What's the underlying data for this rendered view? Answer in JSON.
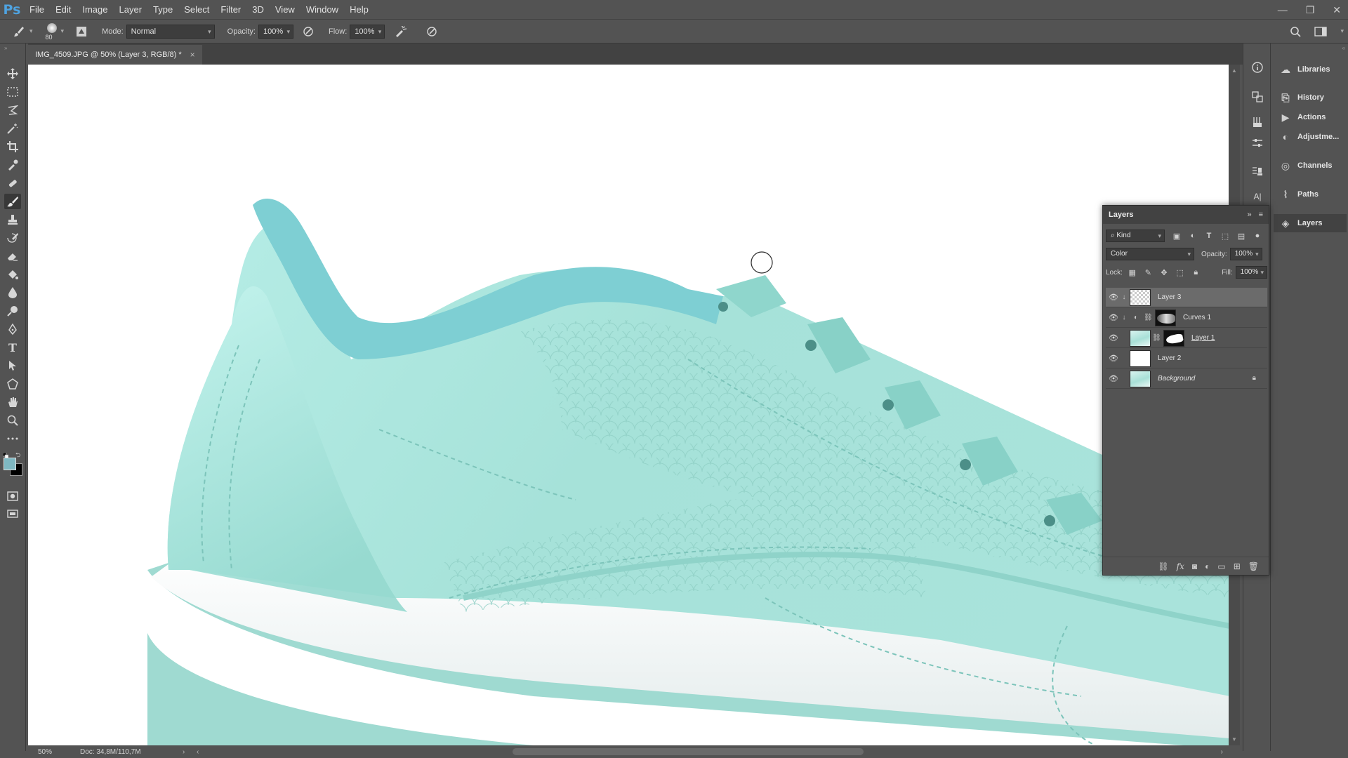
{
  "app": {
    "logo": "Ps"
  },
  "menu": [
    "File",
    "Edit",
    "Image",
    "Layer",
    "Type",
    "Select",
    "Filter",
    "3D",
    "View",
    "Window",
    "Help"
  ],
  "window_controls": {
    "minimize": "—",
    "restore": "❐",
    "close": "✕"
  },
  "options_bar": {
    "brush_size": "80",
    "mode_label": "Mode:",
    "mode_value": "Normal",
    "opacity_label": "Opacity:",
    "opacity_value": "100%",
    "flow_label": "Flow:",
    "flow_value": "100%"
  },
  "document_tab": {
    "title": "IMG_4509.JPG @ 50% (Layer 3, RGB/8) *",
    "close": "×"
  },
  "status_bar": {
    "zoom": "50%",
    "doc_size": "Doc: 34,8M/110,7M"
  },
  "panel_list": [
    "Libraries",
    "History",
    "Actions",
    "Adjustme...",
    "Channels",
    "Paths",
    "Layers"
  ],
  "layers_panel": {
    "tab_label": "Layers",
    "filter_kind": "Kind",
    "blend_mode": "Color",
    "opacity_label": "Opacity:",
    "opacity_value": "100%",
    "lock_label": "Lock:",
    "fill_label": "Fill:",
    "fill_value": "100%",
    "layers": [
      {
        "name": "Layer 3",
        "selected": true,
        "clipped": true
      },
      {
        "name": "Curves 1",
        "selected": false,
        "clipped": true
      },
      {
        "name": "Layer 1",
        "selected": false,
        "clipped": false
      },
      {
        "name": "Layer 2",
        "selected": false,
        "clipped": false
      },
      {
        "name": "Background",
        "selected": false,
        "clipped": false,
        "locked": true
      }
    ]
  },
  "colors": {
    "ui_bg": "#535353",
    "foreground_swatch": "#7fb8c2",
    "background_swatch": "#000000",
    "shoe_mint": "#a8e3da",
    "collar": "#7ecfd3"
  },
  "tools": [
    "move-icon",
    "marquee-icon",
    "lasso-icon",
    "magic-wand-icon",
    "crop-icon",
    "eyedropper-icon",
    "healing-icon",
    "brush-icon",
    "stamp-icon",
    "history-brush-icon",
    "eraser-icon",
    "paint-bucket-icon",
    "blur-icon",
    "dodge-icon",
    "pen-icon",
    "type-icon",
    "path-select-icon",
    "shape-icon",
    "hand-icon",
    "zoom-icon",
    "more-icon"
  ]
}
